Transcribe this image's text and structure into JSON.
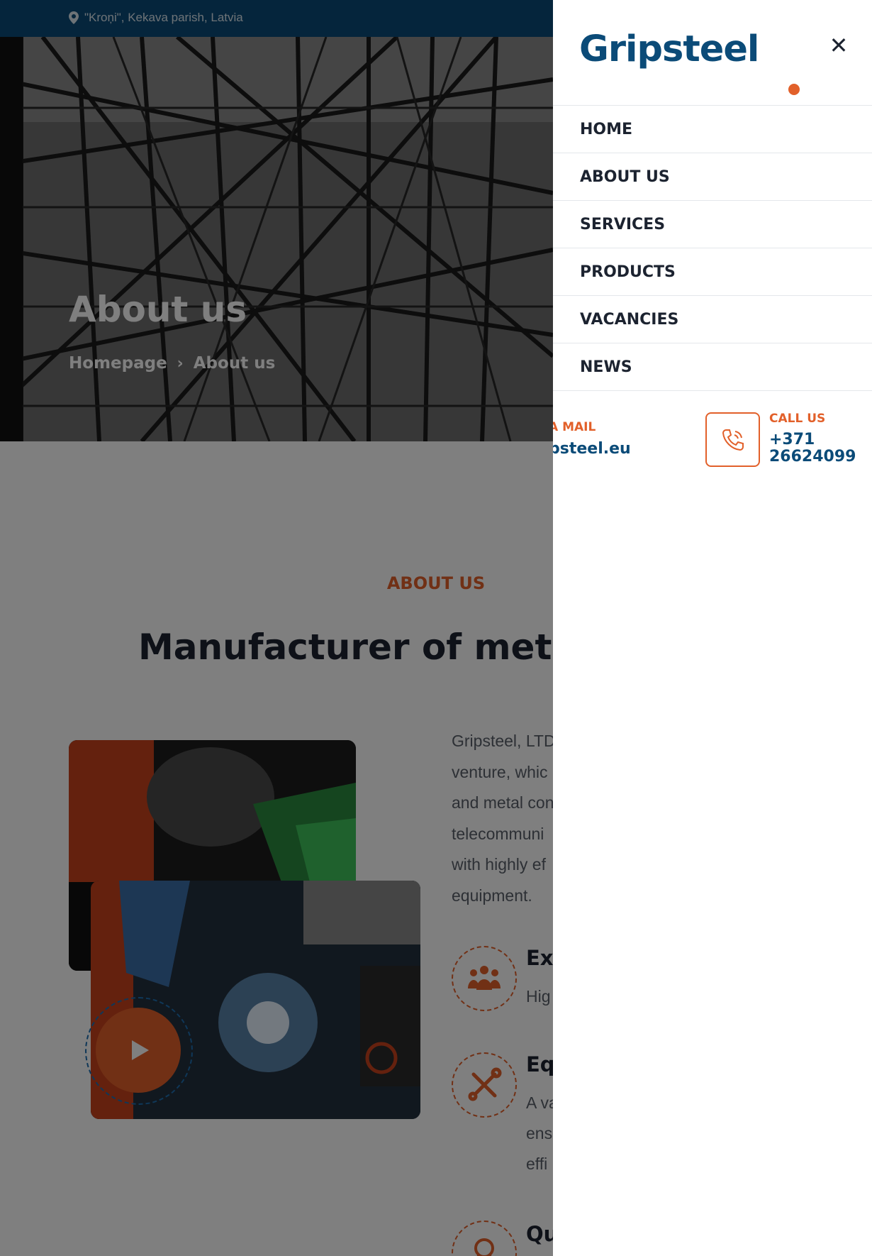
{
  "topbar": {
    "location": "\"Kroņi\", Kekava parish, Latvia"
  },
  "hero": {
    "title": "About us",
    "breadcrumb": {
      "home": "Homepage",
      "current": "About us"
    }
  },
  "about": {
    "eyebrow": "ABOUT US",
    "headline": "Manufacturer of metal s",
    "paragraph_lines": [
      "Gripsteel, LTD",
      "venture, whic",
      "and metal con",
      "telecommuni",
      "with highly ef",
      "equipment."
    ],
    "features": [
      {
        "icon": "team-icon",
        "title": "Exp",
        "text": [
          "Hig"
        ]
      },
      {
        "icon": "tools-icon",
        "title": "Eq",
        "text": [
          "A va",
          "ens",
          "effi"
        ]
      },
      {
        "icon": "award-icon",
        "title": "Qu",
        "text": []
      }
    ]
  },
  "menu": {
    "logo": "Gripsteel",
    "items": [
      "HOME",
      "ABOUT US",
      "SERVICES",
      "PRODUCTS",
      "VACANCIES",
      "NEWS"
    ],
    "mail_label": "A MAIL",
    "mail_value": "psteel.eu",
    "call_label": "CALL US",
    "call_value": "+371 26624099"
  },
  "colors": {
    "brand_blue": "#0b4b78",
    "accent_orange": "#e2602a",
    "text_dark": "#1c2330"
  }
}
